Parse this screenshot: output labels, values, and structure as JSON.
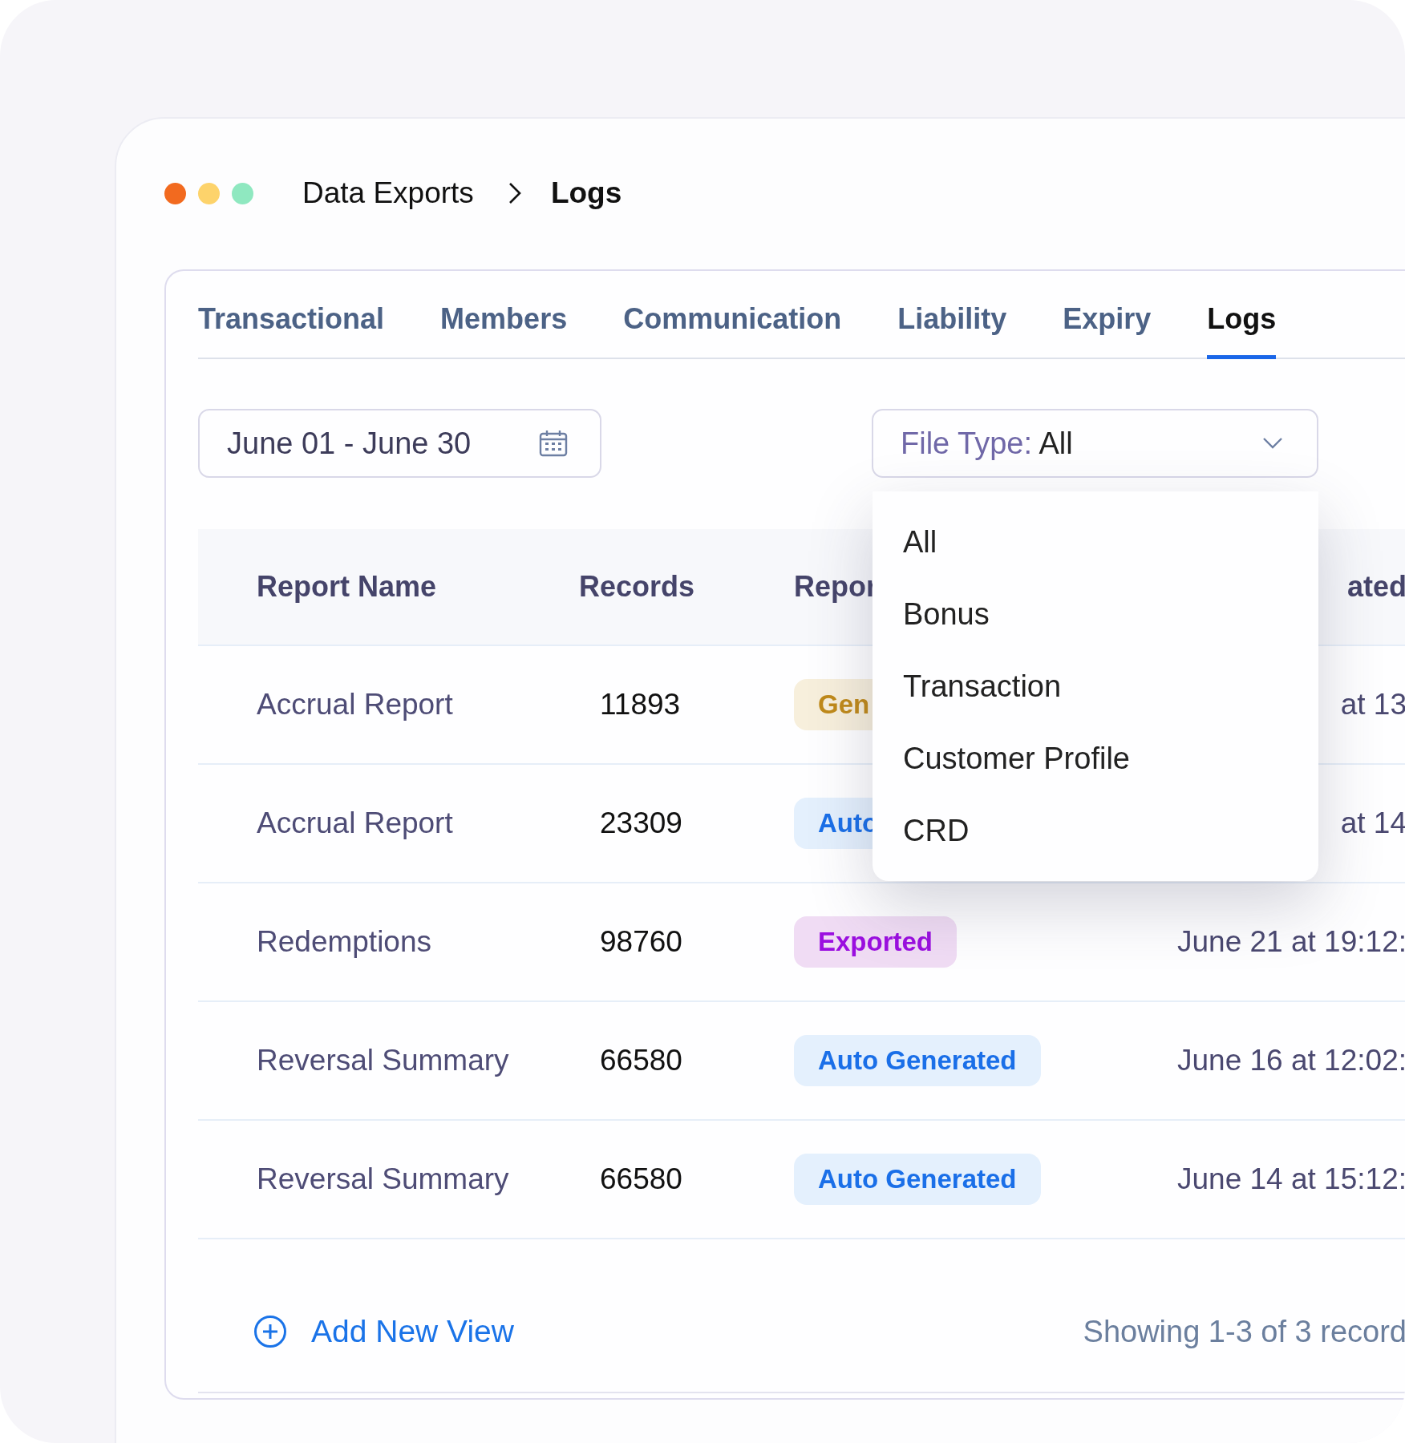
{
  "breadcrumb": {
    "parent": "Data Exports",
    "current": "Logs"
  },
  "tabs": [
    {
      "label": "Transactional",
      "selected": false
    },
    {
      "label": "Members",
      "selected": false
    },
    {
      "label": "Communication",
      "selected": false
    },
    {
      "label": "Liability",
      "selected": false
    },
    {
      "label": "Expiry",
      "selected": false
    },
    {
      "label": "Logs",
      "selected": true
    }
  ],
  "date_range": {
    "value": "June 01 - June 30"
  },
  "file_type": {
    "label": "File Type:",
    "value": "All"
  },
  "file_type_menu": {
    "options": [
      "All",
      "Bonus",
      "Transaction",
      "Customer Profile",
      "CRD"
    ]
  },
  "table": {
    "columns": [
      "Report Name",
      "Records",
      "Repor",
      "ated"
    ],
    "rows": [
      {
        "report_name": "Accrual Report",
        "records": "11893",
        "status": {
          "label": "Gen",
          "kind": "generated"
        },
        "date": "at 13"
      },
      {
        "report_name": "Accrual Report",
        "records": "23309",
        "status": {
          "label": "Auto",
          "kind": "auto"
        },
        "date": "at 14"
      },
      {
        "report_name": "Redemptions",
        "records": "98760",
        "status": {
          "label": "Exported",
          "kind": "exported"
        },
        "date": "June 21 at 19:12:"
      },
      {
        "report_name": "Reversal Summary",
        "records": "66580",
        "status": {
          "label": "Auto Generated",
          "kind": "auto"
        },
        "date": "June 16 at 12:02:"
      },
      {
        "report_name": "Reversal Summary",
        "records": "66580",
        "status": {
          "label": "Auto Generated",
          "kind": "auto"
        },
        "date": "June 14 at 15:12:"
      }
    ]
  },
  "footer": {
    "add_view": "Add New View",
    "summary": "Showing 1-3 of 3 record"
  }
}
